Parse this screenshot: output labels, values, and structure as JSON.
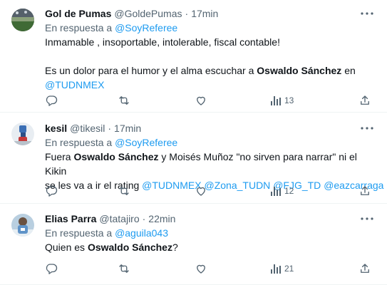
{
  "tweets": [
    {
      "name": "Gol de Pumas",
      "handle": "@GoldePumas",
      "dot": "·",
      "time": "17min",
      "reply_prefix": "En respuesta a",
      "reply_to": "@SoyReferee",
      "line1": "Inmamable , insoportable, intolerable, fiscal contable!",
      "line2a": "Es un dolor para el humor y el alma escuchar a ",
      "line2b": "Oswaldo Sánchez",
      "line2c": " en",
      "line3": "@TUDNMEX",
      "views": "13"
    },
    {
      "name": "kesil",
      "handle": "@tikesil",
      "dot": "·",
      "time": "17min",
      "reply_prefix": "En respuesta a",
      "reply_to": "@SoyReferee",
      "l1a": "Fuera ",
      "l1b": "Oswaldo Sánchez",
      "l1c": " y Moisés Muñoz \"no sirven para narrar\" ni el Kikin",
      "l2a": "se les va a ir el rating ",
      "m1": "@TUDNMEX",
      "m2": "@Zona_TUDN",
      "m3": "@FJG_TD",
      "m4": "@eazcarraga",
      "views": "12"
    },
    {
      "name": "Elias Parra",
      "handle": "@tatajiro",
      "dot": "·",
      "time": "22min",
      "reply_prefix": "En respuesta a",
      "reply_to": "@aguila043",
      "l1a": "Quien es ",
      "l1b": "Oswaldo Sánchez",
      "l1c": "?",
      "views": "21"
    }
  ],
  "colors": {
    "link": "#1d9bf0",
    "muted": "#536471",
    "text": "#0f1419"
  }
}
